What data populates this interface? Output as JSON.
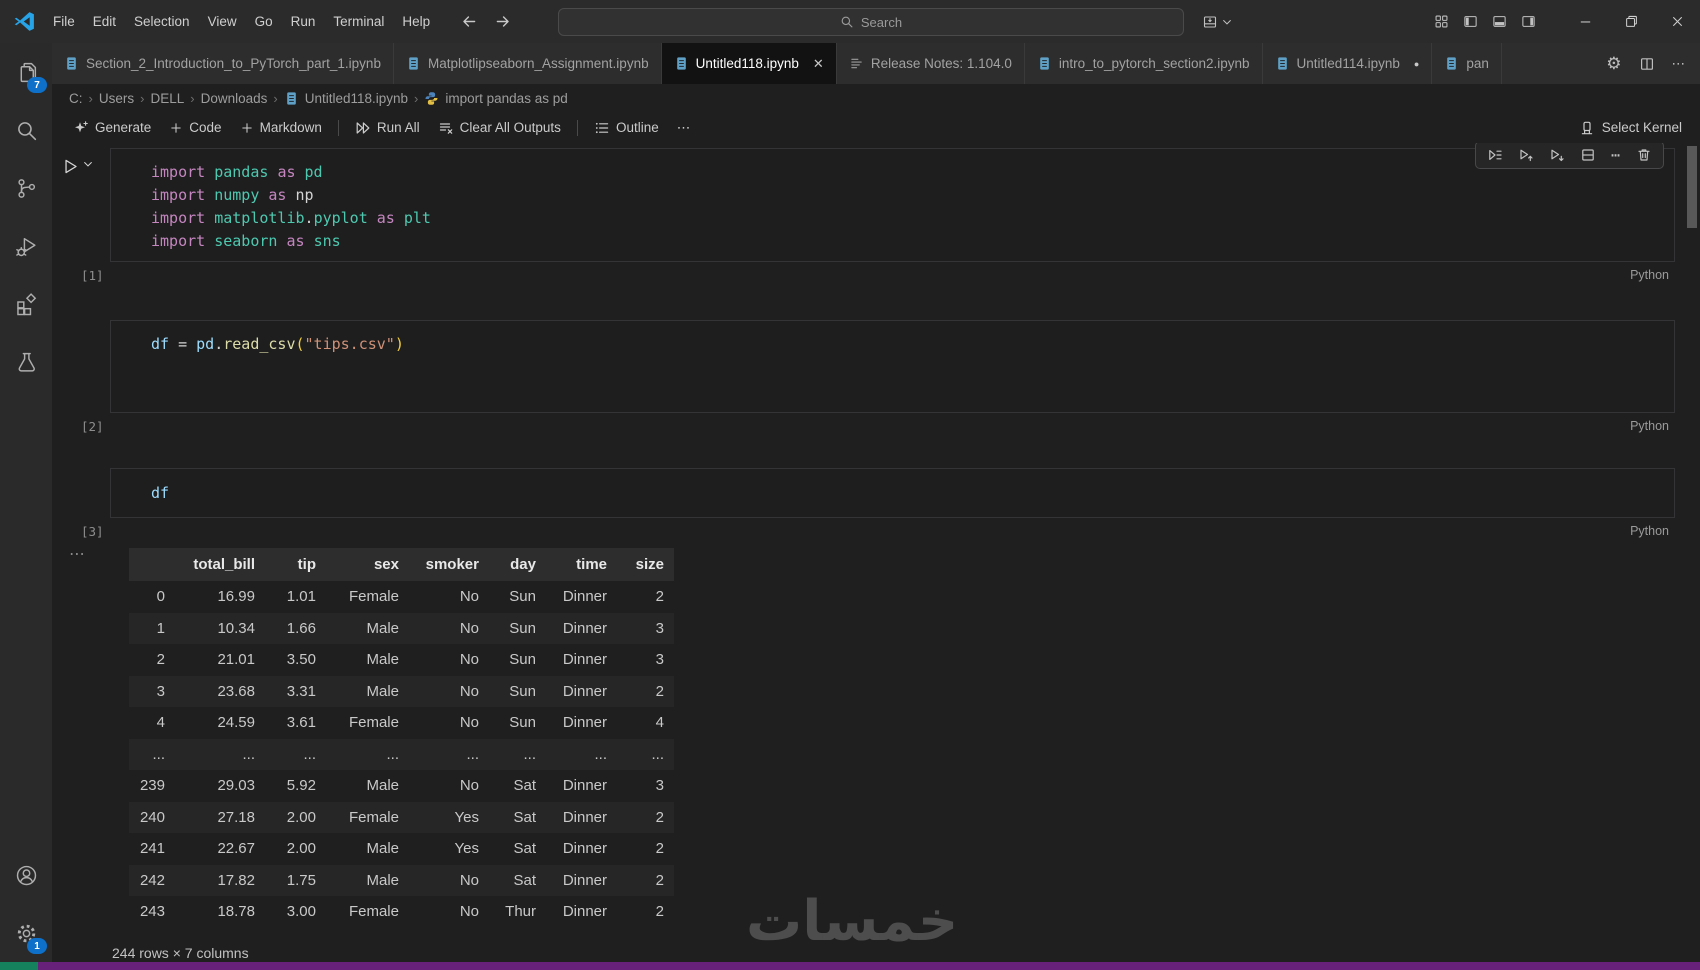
{
  "titlebar": {
    "menus": [
      "File",
      "Edit",
      "Selection",
      "View",
      "Go",
      "Run",
      "Terminal",
      "Help"
    ],
    "search_placeholder": "Search"
  },
  "icons": {
    "more": "⋯",
    "close": "✕",
    "dirty_dot": "●",
    "gear": "⚙",
    "output_collapse": "⋯",
    "breadcrumb_chevron": "›"
  },
  "tabs": [
    {
      "label": "Section_2_Introduction_to_PyTorch_part_1.ipynb",
      "icon": "notebook",
      "active": false
    },
    {
      "label": "Matplotlipseaborn_Assignment.ipynb",
      "icon": "notebook",
      "active": false
    },
    {
      "label": "Untitled118.ipynb",
      "icon": "notebook",
      "active": true,
      "closable": true
    },
    {
      "label": "Release Notes: 1.104.0",
      "icon": "list",
      "active": false
    },
    {
      "label": "intro_to_pytorch_section2.ipynb",
      "icon": "notebook",
      "active": false
    },
    {
      "label": "Untitled114.ipynb",
      "icon": "notebook",
      "active": false,
      "dirty": true
    },
    {
      "label": "pan",
      "icon": "notebook",
      "active": false,
      "truncated": true
    }
  ],
  "breadcrumb": [
    {
      "label": "C:"
    },
    {
      "label": "Users"
    },
    {
      "label": "DELL"
    },
    {
      "label": "Downloads"
    },
    {
      "label": "Untitled118.ipynb",
      "icon": "notebook"
    },
    {
      "label": "import pandas as pd",
      "icon": "python"
    }
  ],
  "notebook_toolbar": {
    "items": [
      {
        "label": "Generate",
        "icon": "sparkle"
      },
      {
        "label": "Code",
        "icon": "plus"
      },
      {
        "label": "Markdown",
        "icon": "plus"
      },
      {
        "sep": true
      },
      {
        "label": "Run All",
        "icon": "run-all"
      },
      {
        "label": "Clear All Outputs",
        "icon": "clear-outputs"
      },
      {
        "sep": true
      },
      {
        "label": "Outline",
        "icon": "outline"
      },
      {
        "label": "",
        "icon": "more"
      }
    ],
    "kernel_label": "Select Kernel"
  },
  "cells": [
    {
      "exec": "[1]",
      "lang": "Python",
      "lines": [
        [
          {
            "t": "import ",
            "c": "kw"
          },
          {
            "t": "pandas ",
            "c": "mod"
          },
          {
            "t": "as ",
            "c": "kw"
          },
          {
            "t": "pd",
            "c": "mod"
          }
        ],
        [
          {
            "t": "import ",
            "c": "kw"
          },
          {
            "t": "numpy ",
            "c": "mod"
          },
          {
            "t": "as ",
            "c": "kw"
          },
          {
            "t": "np",
            "c": "pln"
          }
        ],
        [
          {
            "t": "import ",
            "c": "kw"
          },
          {
            "t": "matplotlib",
            "c": "mod"
          },
          {
            "t": ".",
            "c": "pln"
          },
          {
            "t": "pyplot ",
            "c": "mod"
          },
          {
            "t": "as ",
            "c": "kw"
          },
          {
            "t": "plt",
            "c": "mod"
          }
        ],
        [
          {
            "t": "import ",
            "c": "kw"
          },
          {
            "t": "seaborn ",
            "c": "mod"
          },
          {
            "t": "as ",
            "c": "kw"
          },
          {
            "t": "sns",
            "c": "mod"
          }
        ]
      ]
    },
    {
      "exec": "[2]",
      "lang": "Python",
      "lines": [
        [
          {
            "t": "df ",
            "c": "var"
          },
          {
            "t": "= ",
            "c": "pln"
          },
          {
            "t": "pd",
            "c": "var"
          },
          {
            "t": ".",
            "c": "pln"
          },
          {
            "t": "read_csv",
            "c": "fn"
          },
          {
            "t": "(",
            "c": "brk"
          },
          {
            "t": "\"tips.csv\"",
            "c": "str"
          },
          {
            "t": ")",
            "c": "brk"
          }
        ]
      ]
    },
    {
      "exec": "[3]",
      "lang": "Python",
      "lines": [
        [
          {
            "t": "df",
            "c": "var"
          }
        ]
      ]
    }
  ],
  "cell_toolbar": [
    "execute-row",
    "execute-above",
    "execute-below",
    "split-cell",
    "more",
    "delete"
  ],
  "output_table": {
    "columns": [
      "",
      "total_bill",
      "tip",
      "sex",
      "smoker",
      "day",
      "time",
      "size"
    ],
    "rows": [
      [
        "0",
        "16.99",
        "1.01",
        "Female",
        "No",
        "Sun",
        "Dinner",
        "2"
      ],
      [
        "1",
        "10.34",
        "1.66",
        "Male",
        "No",
        "Sun",
        "Dinner",
        "3"
      ],
      [
        "2",
        "21.01",
        "3.50",
        "Male",
        "No",
        "Sun",
        "Dinner",
        "3"
      ],
      [
        "3",
        "23.68",
        "3.31",
        "Male",
        "No",
        "Sun",
        "Dinner",
        "2"
      ],
      [
        "4",
        "24.59",
        "3.61",
        "Female",
        "No",
        "Sun",
        "Dinner",
        "4"
      ],
      [
        "...",
        "...",
        "...",
        "...",
        "...",
        "...",
        "...",
        "..."
      ],
      [
        "239",
        "29.03",
        "5.92",
        "Male",
        "No",
        "Sat",
        "Dinner",
        "3"
      ],
      [
        "240",
        "27.18",
        "2.00",
        "Female",
        "Yes",
        "Sat",
        "Dinner",
        "2"
      ],
      [
        "241",
        "22.67",
        "2.00",
        "Male",
        "Yes",
        "Sat",
        "Dinner",
        "2"
      ],
      [
        "242",
        "17.82",
        "1.75",
        "Male",
        "No",
        "Sat",
        "Dinner",
        "2"
      ],
      [
        "243",
        "18.78",
        "3.00",
        "Female",
        "No",
        "Thur",
        "Dinner",
        "2"
      ]
    ],
    "footer": "244 rows × 7 columns"
  },
  "activity_bar": {
    "top": [
      {
        "name": "explorer",
        "badge": "7"
      },
      {
        "name": "search"
      },
      {
        "name": "source-control"
      },
      {
        "name": "run-and-debug"
      },
      {
        "name": "extensions"
      },
      {
        "name": "testing"
      }
    ],
    "bottom": [
      {
        "name": "account"
      },
      {
        "name": "manage",
        "badge": "1"
      }
    ]
  },
  "statusbar": {
    "bar_color": "#68217a",
    "remote_color": "#16825d"
  },
  "watermark": "خمسات",
  "colors": {
    "badge": "#0e70c8",
    "active_tab_bg": "#121212",
    "accent": "#0078d4"
  }
}
